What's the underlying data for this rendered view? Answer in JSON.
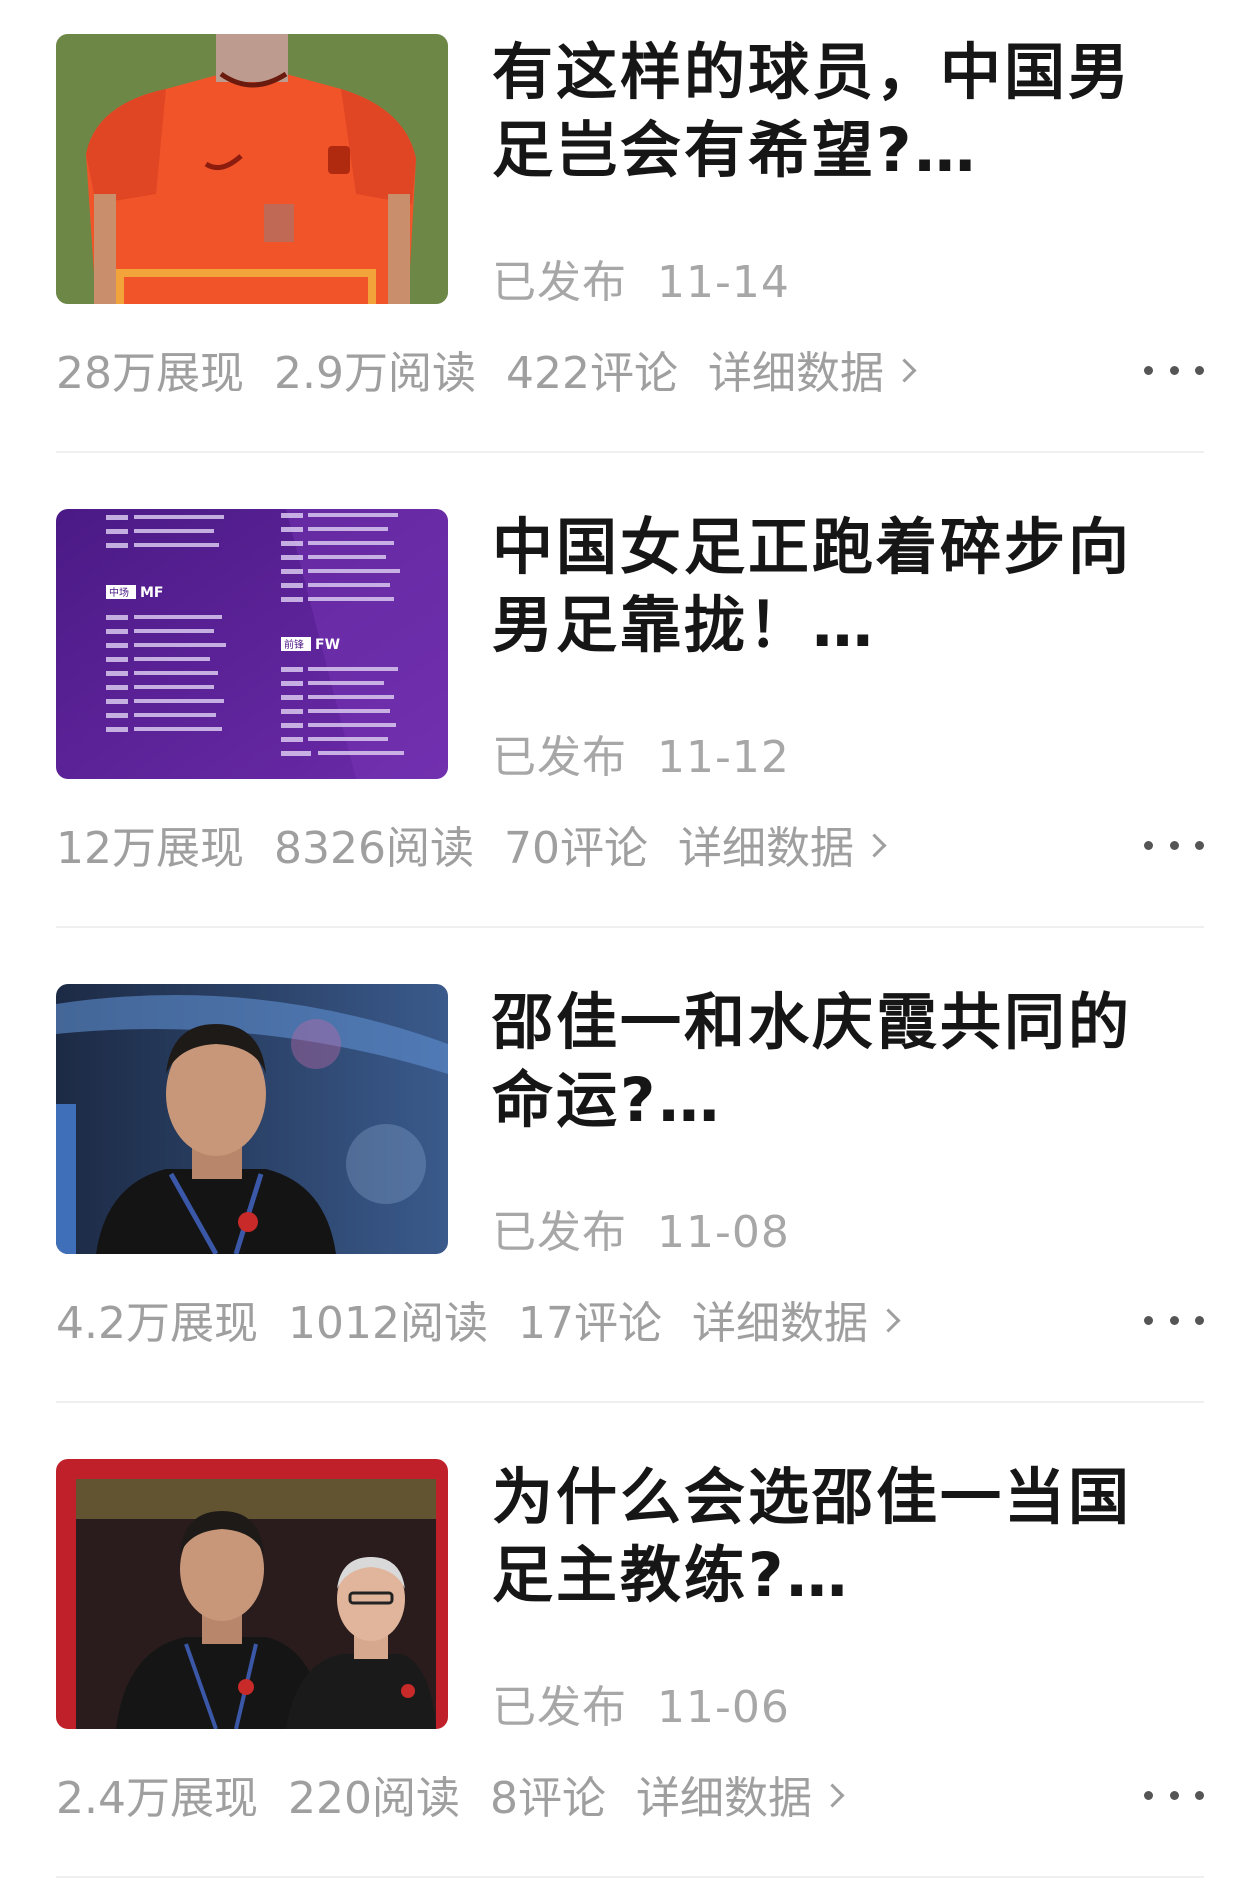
{
  "articles": [
    {
      "title": "有这样的球员，中国男足岂会有希望?…",
      "published_label": "已发布",
      "date": "11-14",
      "impressions": "28万展现",
      "reads": "2.9万阅读",
      "comments": "422评论",
      "detail_label": "详细数据"
    },
    {
      "title": "中国女足正跑着碎步向男足靠拢！…",
      "published_label": "已发布",
      "date": "11-12",
      "impressions": "12万展现",
      "reads": "8326阅读",
      "comments": "70评论",
      "detail_label": "详细数据"
    },
    {
      "title": "邵佳一和水庆霞共同的命运?…",
      "published_label": "已发布",
      "date": "11-08",
      "impressions": "4.2万展现",
      "reads": "1012阅读",
      "comments": "17评论",
      "detail_label": "详细数据"
    },
    {
      "title": "为什么会选邵佳一当国足主教练?…",
      "published_label": "已发布",
      "date": "11-06",
      "impressions": "2.4万展现",
      "reads": "220阅读",
      "comments": "8评论",
      "detail_label": "详细数据"
    }
  ],
  "thumbnail_roster_text": {
    "mf_label": "中场",
    "mf_code": "MF",
    "fw_label": "前锋",
    "fw_code": "FW"
  },
  "colors": {
    "title": "#161616",
    "meta": "#a7a7a7",
    "stats": "#9f9f9f",
    "divider": "#efefef",
    "jersey_orange": "#f2542a",
    "roster_purple": "#5d2396"
  }
}
